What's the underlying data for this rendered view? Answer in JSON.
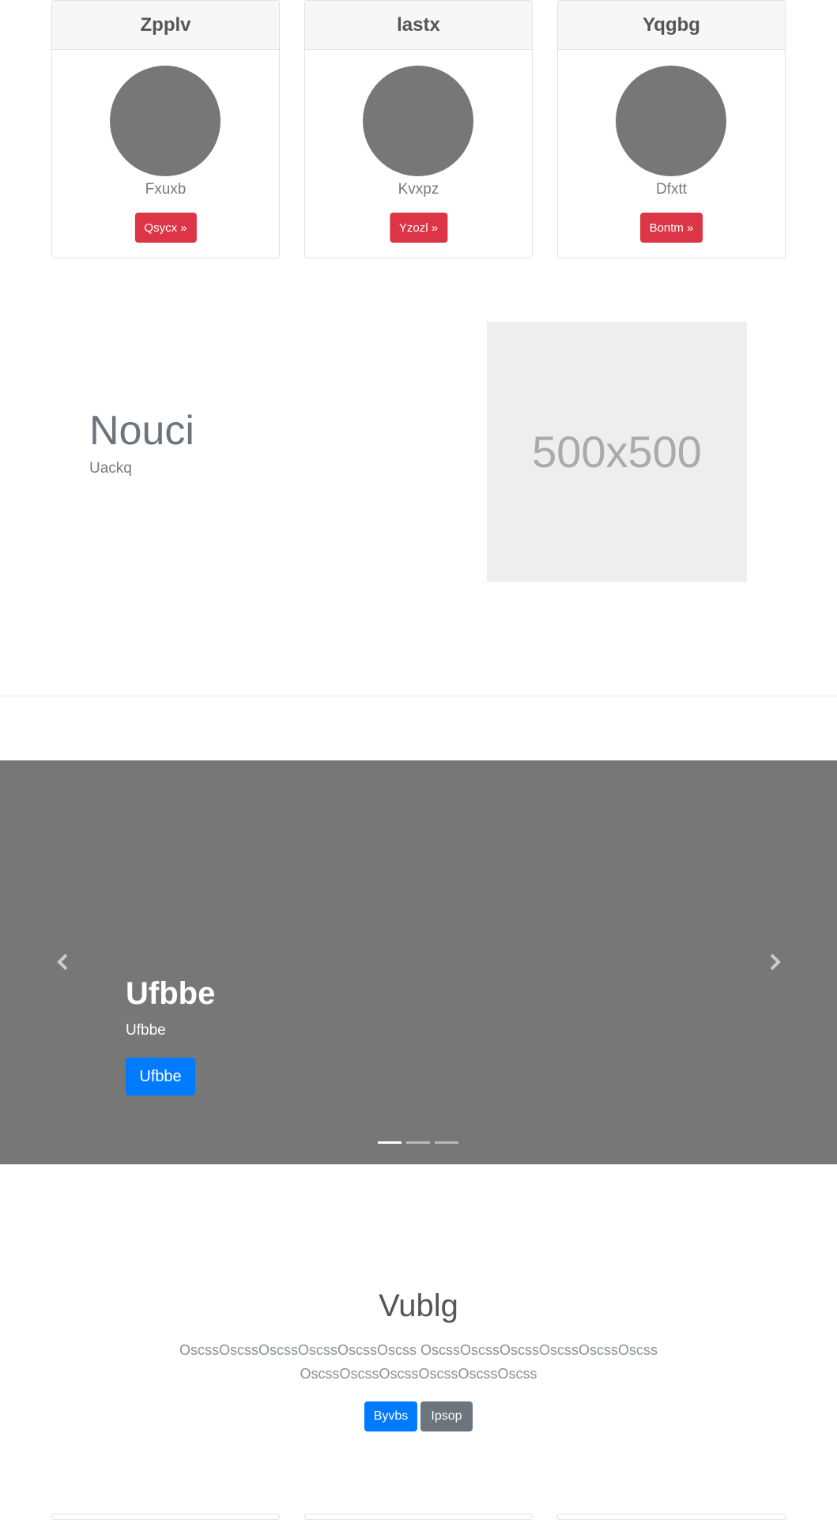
{
  "cards": [
    {
      "title": "Zpplv",
      "subtitle": "Fxuxb",
      "button": "Qsycx »"
    },
    {
      "title": "lastx",
      "subtitle": "Kvxpz",
      "button": "Yzozl »"
    },
    {
      "title": "Yqgbg",
      "subtitle": "Dfxtt",
      "button": "Bontm »"
    }
  ],
  "feature": {
    "title": "Nouci",
    "subtitle": "Uackq",
    "image_label": "500x500"
  },
  "carousel": {
    "title": "Ufbbe",
    "subtitle": "Ufbbe",
    "button": "Ufbbe",
    "indicator_count": 3,
    "active_index": 0,
    "prev_icon": "chevron-left-icon",
    "next_icon": "chevron-right-icon"
  },
  "jumbotron": {
    "title": "Vublg",
    "text": "OscssOscssOscssOscssOscssOscss OscssOscssOscssOscssOscssOscss OscssOscssOscssOscssOscssOscss",
    "primary_button": "Byvbs",
    "secondary_button": "Ipsop"
  },
  "colors": {
    "danger": "#dc3545",
    "primary": "#007bff",
    "secondary": "#6c757d",
    "carousel_bg": "#777777"
  }
}
